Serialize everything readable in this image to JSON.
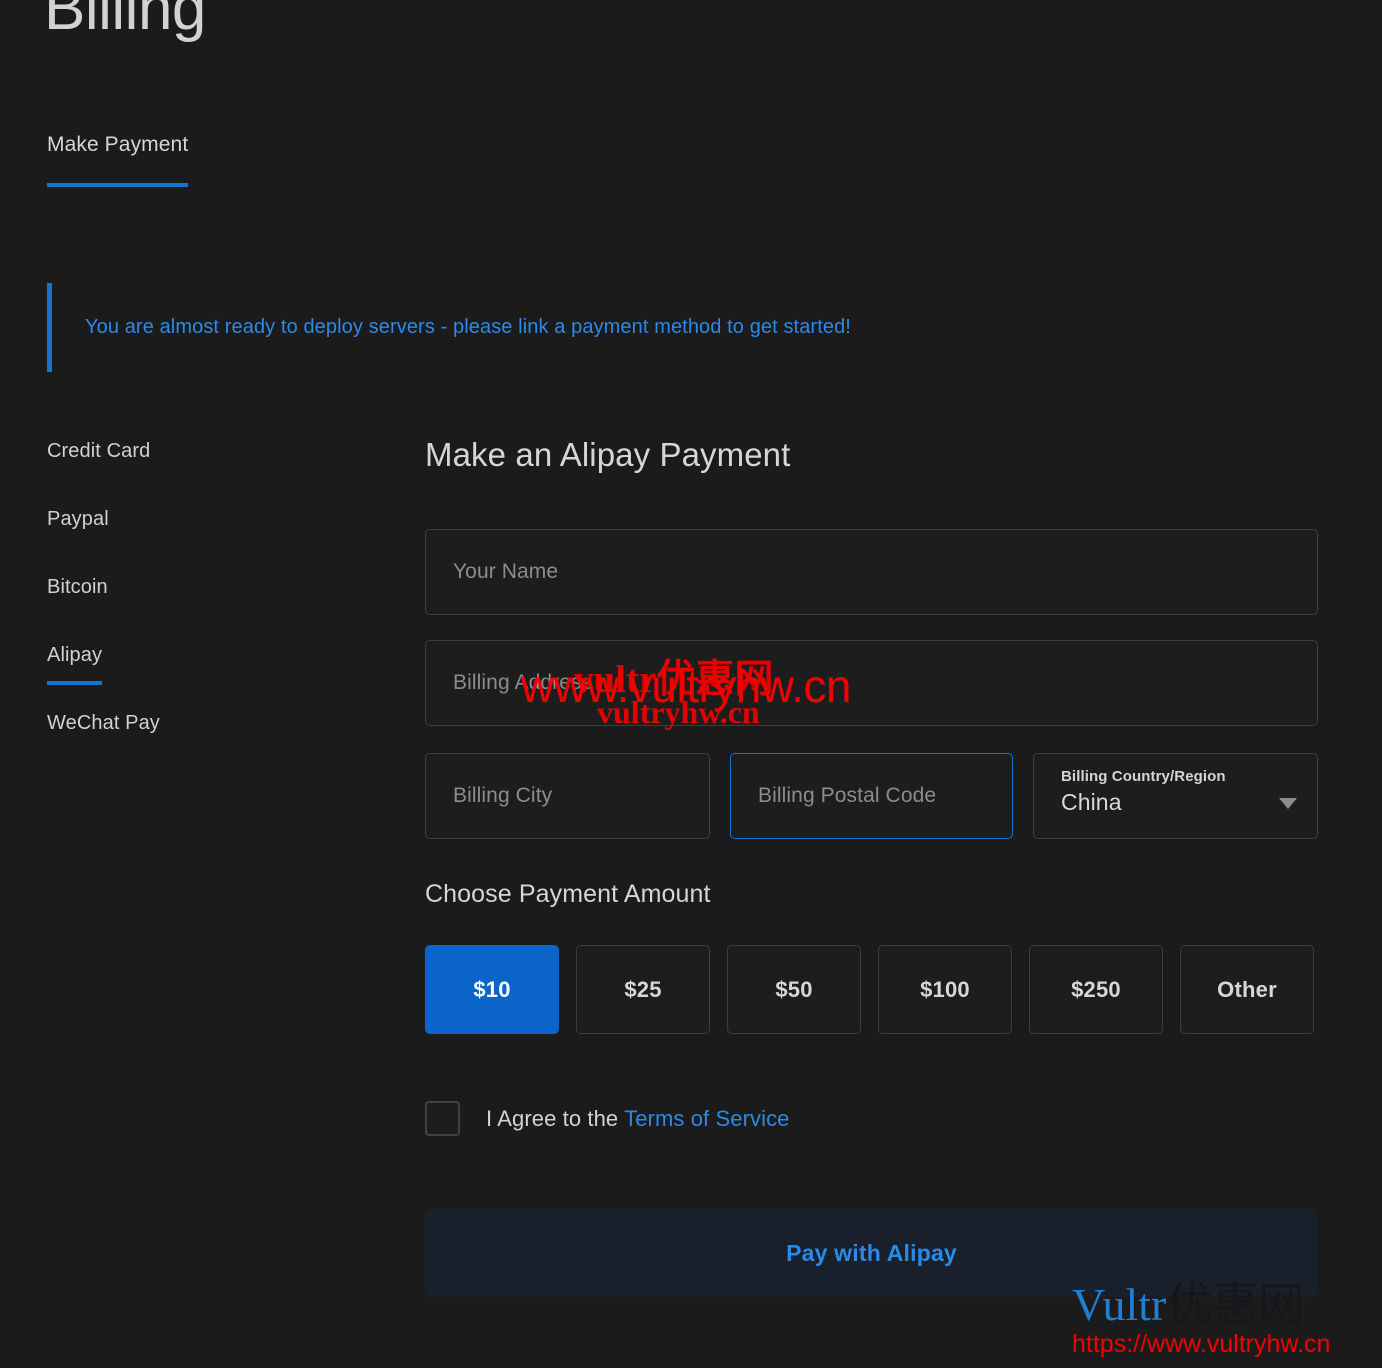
{
  "page": {
    "title": "Billing",
    "background_color": "#1b1b1b",
    "accent_color": "#1573d1",
    "link_color": "#2b8ae8"
  },
  "tabs": [
    {
      "label": "Make Payment",
      "active": true
    }
  ],
  "alert": {
    "message": "You are almost ready to deploy servers - please link a payment method to get started!",
    "accent_color": "#1573d1"
  },
  "payment_methods": [
    {
      "label": "Credit Card",
      "active": false
    },
    {
      "label": "Paypal",
      "active": false
    },
    {
      "label": "Bitcoin",
      "active": false
    },
    {
      "label": "Alipay",
      "active": true
    },
    {
      "label": "WeChat Pay",
      "active": false
    }
  ],
  "form": {
    "title": "Make an Alipay Payment",
    "fields": {
      "name": {
        "placeholder": "Your Name",
        "value": ""
      },
      "address": {
        "placeholder": "Billing Address",
        "value": ""
      },
      "city": {
        "placeholder": "Billing City",
        "value": ""
      },
      "postal": {
        "placeholder": "Billing Postal Code",
        "value": "",
        "focused": true
      },
      "country": {
        "label": "Billing Country/Region",
        "value": "China"
      }
    }
  },
  "amount_section": {
    "title": "Choose Payment Amount",
    "options": [
      {
        "label": "$10",
        "selected": true
      },
      {
        "label": "$25",
        "selected": false
      },
      {
        "label": "$50",
        "selected": false
      },
      {
        "label": "$100",
        "selected": false
      },
      {
        "label": "$250",
        "selected": false
      },
      {
        "label": "Other",
        "selected": false
      }
    ],
    "selected_color": "#0b64c9"
  },
  "terms": {
    "checked": false,
    "prefix": "I Agree to the ",
    "link_label": "Terms of Service"
  },
  "submit": {
    "label": "Pay with Alipay",
    "text_color": "#2b8ae8",
    "background_color": "#191f2b"
  },
  "watermarks": {
    "center_top": "vultr优惠网",
    "center_main": "www.vultryhw.cn",
    "center_bottom": "vultryhw.cn",
    "corner_brand_en": "Vultr",
    "corner_brand_cn": "优惠网",
    "corner_url": "https://www.vultryhw.cn",
    "color": "#e60000"
  }
}
